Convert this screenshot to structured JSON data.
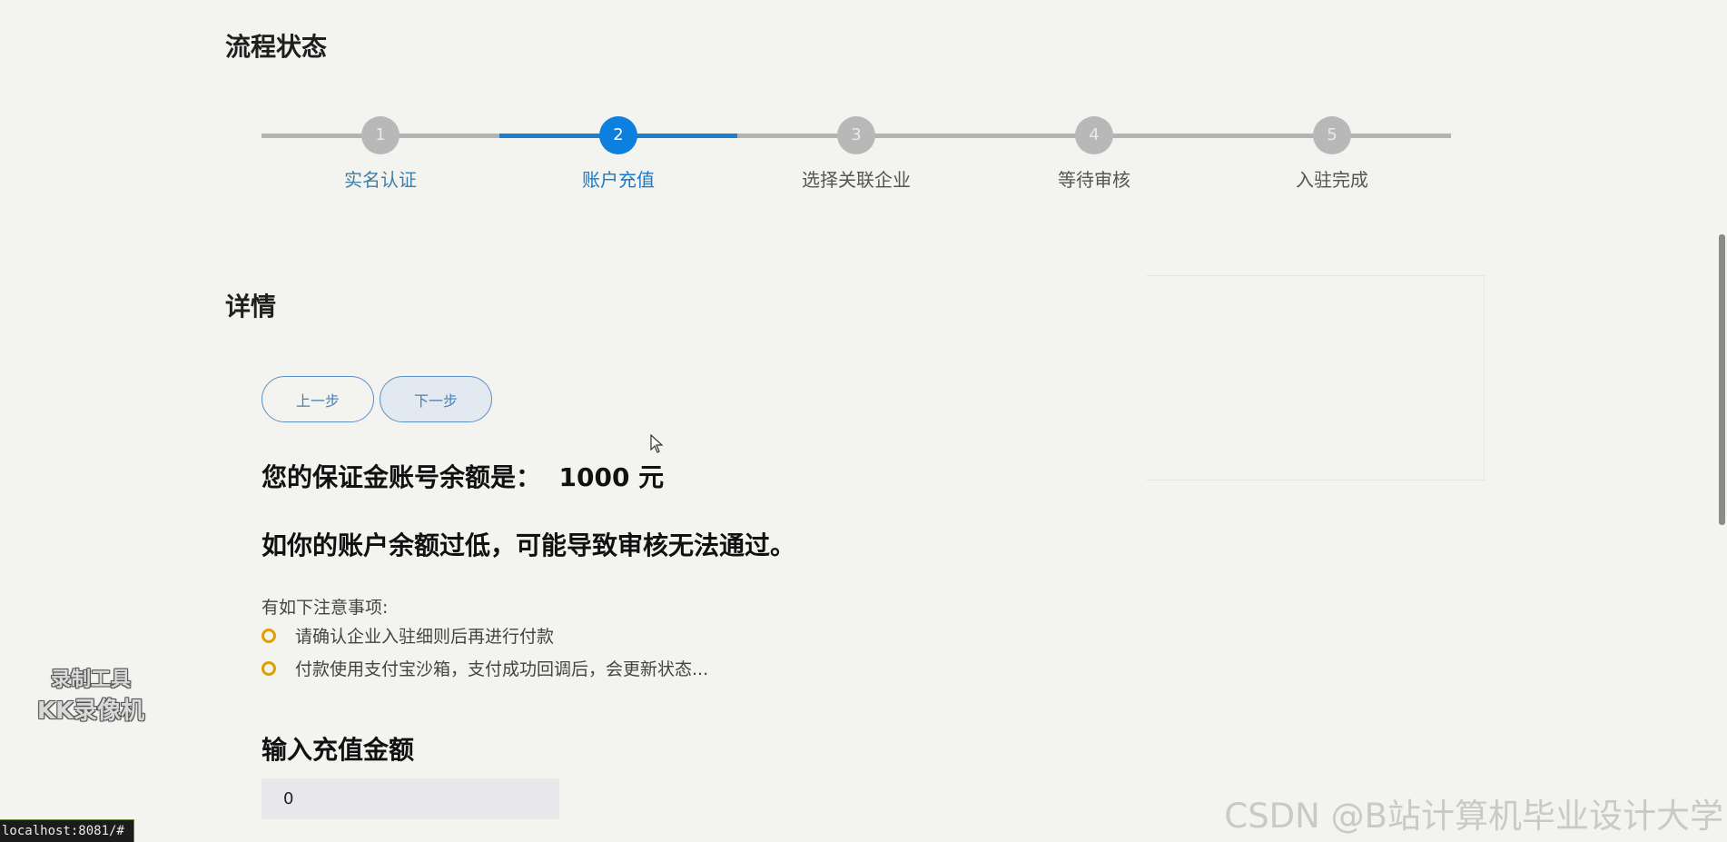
{
  "sections": {
    "process_status_title": "流程状态",
    "detail_title": "详情"
  },
  "steps": [
    {
      "number": "1",
      "label": "实名认证",
      "state": "done"
    },
    {
      "number": "2",
      "label": "账户充值",
      "state": "active"
    },
    {
      "number": "3",
      "label": "选择关联企业",
      "state": "pending"
    },
    {
      "number": "4",
      "label": "等待审核",
      "state": "pending"
    },
    {
      "number": "5",
      "label": "入驻完成",
      "state": "pending"
    }
  ],
  "buttons": {
    "prev": "上一步",
    "next": "下一步"
  },
  "balance": {
    "text": "您的保证金账号余额是：  1000 元"
  },
  "warning": "如你的账户余额过低，可能导致审核无法通过。",
  "notes": {
    "title": "有如下注意事项:",
    "items": [
      "请确认企业入驻细则后再进行付款",
      "付款使用支付宝沙箱，支付成功回调后，会更新状态..."
    ]
  },
  "recharge": {
    "title": "输入充值金额",
    "value": "0"
  },
  "status_bar": "localhost:8081/#",
  "watermarks": {
    "tool_line1": "录制工具",
    "tool_line2": "KK录像机",
    "csdn": "CSDN @B站计算机毕业设计大学"
  },
  "colors": {
    "accent": "#0d7fdc",
    "inactive": "#b8b8b8",
    "bullet": "#e0a000"
  },
  "icons": {
    "cursor": "mouse-pointer-icon",
    "bullet": "circle-outline-icon"
  }
}
